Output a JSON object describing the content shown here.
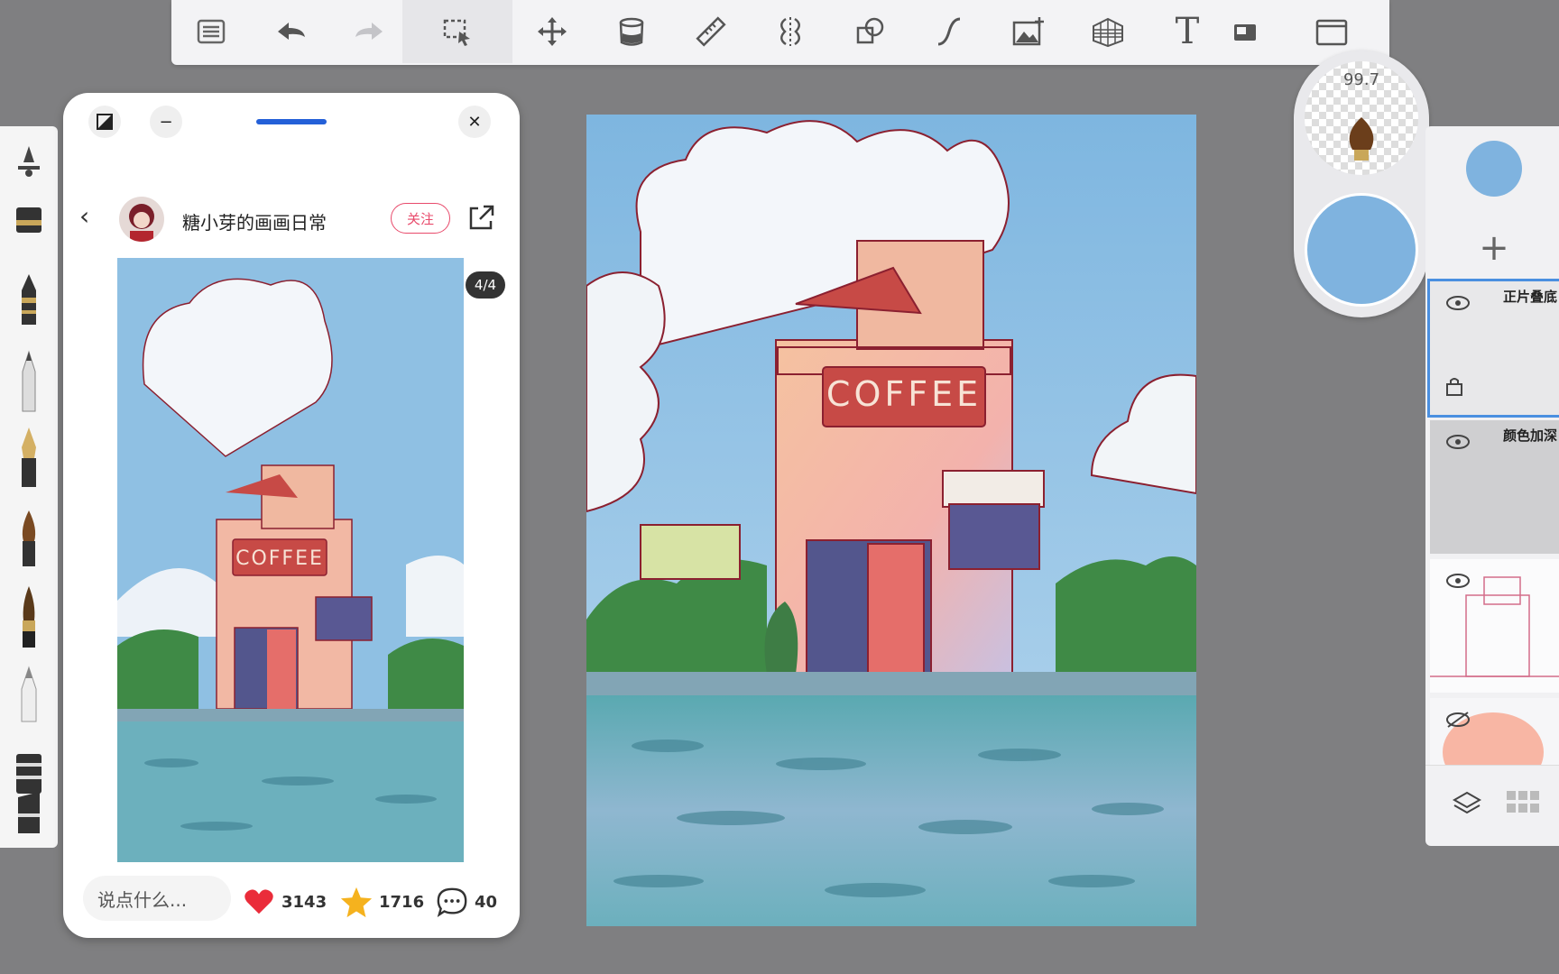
{
  "toolbar": {
    "tools": [
      {
        "name": "menu-icon"
      },
      {
        "name": "undo-icon"
      },
      {
        "name": "redo-icon"
      },
      {
        "name": "selection-icon"
      },
      {
        "name": "move-icon"
      },
      {
        "name": "fill-bucket-icon"
      },
      {
        "name": "ruler-icon"
      },
      {
        "name": "symmetry-icon"
      },
      {
        "name": "shapes-icon"
      },
      {
        "name": "curve-icon"
      },
      {
        "name": "image-insert-icon"
      },
      {
        "name": "perspective-grid-icon"
      },
      {
        "name": "text-icon"
      },
      {
        "name": "reference-icon"
      },
      {
        "name": "fullscreen-icon"
      }
    ],
    "text_tool_glyph": "T",
    "active_tool": "selection-icon"
  },
  "brush_orb": {
    "size_value": "99.7",
    "color": "#7fb3df"
  },
  "layers_panel": {
    "current_color": "#7fb3df",
    "add_label": "+",
    "layers": [
      {
        "name": "正片叠底",
        "visible": true,
        "selected": true
      },
      {
        "name": "颜色加深",
        "visible": true,
        "selected": false
      },
      {
        "name": "",
        "visible": true,
        "selected": false
      },
      {
        "name": "",
        "visible": false,
        "selected": false
      }
    ]
  },
  "reference_panel": {
    "author": "糖小芽的画画日常",
    "follow_label": "关注",
    "pager": "4/4",
    "comment_placeholder": "说点什么...",
    "likes": "3143",
    "favorites": "1716",
    "comments": "40",
    "back_glyph": "‹",
    "close_glyph": "✕",
    "minimize_glyph": "−"
  },
  "artwork": {
    "sign_text": "COFFEE"
  },
  "colors": {
    "sky": "#8fc0e3",
    "water": "#5aa6b0",
    "building": "#f3b7a2",
    "accent": "#d9534f",
    "selection": "#4a8fe0"
  }
}
